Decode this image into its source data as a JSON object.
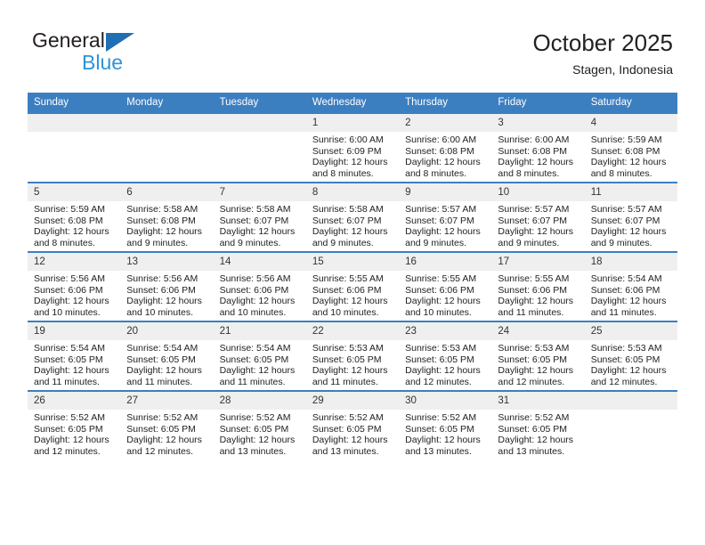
{
  "brand": {
    "name_dark": "General",
    "name_blue": "Blue",
    "accent_blue": "#2e93d8",
    "triangle_blue": "#1f6fb5"
  },
  "header": {
    "title": "October 2025",
    "subtitle": "Stagen, Indonesia"
  },
  "theme": {
    "header_bg": "#3c7fc1",
    "header_text": "#ffffff",
    "daynum_bg": "#efefef",
    "cell_bg": "#ffffff"
  },
  "weekdays": [
    "Sunday",
    "Monday",
    "Tuesday",
    "Wednesday",
    "Thursday",
    "Friday",
    "Saturday"
  ],
  "labels": {
    "sunrise_prefix": "Sunrise:",
    "sunset_prefix": "Sunset:",
    "daylight_prefix": "Daylight:"
  },
  "weeks": [
    [
      {
        "day": "",
        "sunrise": "",
        "sunset": "",
        "daylight_line1": "",
        "daylight_line2": ""
      },
      {
        "day": "",
        "sunrise": "",
        "sunset": "",
        "daylight_line1": "",
        "daylight_line2": ""
      },
      {
        "day": "",
        "sunrise": "",
        "sunset": "",
        "daylight_line1": "",
        "daylight_line2": ""
      },
      {
        "day": "1",
        "sunrise": "Sunrise: 6:00 AM",
        "sunset": "Sunset: 6:09 PM",
        "daylight_line1": "Daylight: 12 hours",
        "daylight_line2": "and 8 minutes."
      },
      {
        "day": "2",
        "sunrise": "Sunrise: 6:00 AM",
        "sunset": "Sunset: 6:08 PM",
        "daylight_line1": "Daylight: 12 hours",
        "daylight_line2": "and 8 minutes."
      },
      {
        "day": "3",
        "sunrise": "Sunrise: 6:00 AM",
        "sunset": "Sunset: 6:08 PM",
        "daylight_line1": "Daylight: 12 hours",
        "daylight_line2": "and 8 minutes."
      },
      {
        "day": "4",
        "sunrise": "Sunrise: 5:59 AM",
        "sunset": "Sunset: 6:08 PM",
        "daylight_line1": "Daylight: 12 hours",
        "daylight_line2": "and 8 minutes."
      }
    ],
    [
      {
        "day": "5",
        "sunrise": "Sunrise: 5:59 AM",
        "sunset": "Sunset: 6:08 PM",
        "daylight_line1": "Daylight: 12 hours",
        "daylight_line2": "and 8 minutes."
      },
      {
        "day": "6",
        "sunrise": "Sunrise: 5:58 AM",
        "sunset": "Sunset: 6:08 PM",
        "daylight_line1": "Daylight: 12 hours",
        "daylight_line2": "and 9 minutes."
      },
      {
        "day": "7",
        "sunrise": "Sunrise: 5:58 AM",
        "sunset": "Sunset: 6:07 PM",
        "daylight_line1": "Daylight: 12 hours",
        "daylight_line2": "and 9 minutes."
      },
      {
        "day": "8",
        "sunrise": "Sunrise: 5:58 AM",
        "sunset": "Sunset: 6:07 PM",
        "daylight_line1": "Daylight: 12 hours",
        "daylight_line2": "and 9 minutes."
      },
      {
        "day": "9",
        "sunrise": "Sunrise: 5:57 AM",
        "sunset": "Sunset: 6:07 PM",
        "daylight_line1": "Daylight: 12 hours",
        "daylight_line2": "and 9 minutes."
      },
      {
        "day": "10",
        "sunrise": "Sunrise: 5:57 AM",
        "sunset": "Sunset: 6:07 PM",
        "daylight_line1": "Daylight: 12 hours",
        "daylight_line2": "and 9 minutes."
      },
      {
        "day": "11",
        "sunrise": "Sunrise: 5:57 AM",
        "sunset": "Sunset: 6:07 PM",
        "daylight_line1": "Daylight: 12 hours",
        "daylight_line2": "and 9 minutes."
      }
    ],
    [
      {
        "day": "12",
        "sunrise": "Sunrise: 5:56 AM",
        "sunset": "Sunset: 6:06 PM",
        "daylight_line1": "Daylight: 12 hours",
        "daylight_line2": "and 10 minutes."
      },
      {
        "day": "13",
        "sunrise": "Sunrise: 5:56 AM",
        "sunset": "Sunset: 6:06 PM",
        "daylight_line1": "Daylight: 12 hours",
        "daylight_line2": "and 10 minutes."
      },
      {
        "day": "14",
        "sunrise": "Sunrise: 5:56 AM",
        "sunset": "Sunset: 6:06 PM",
        "daylight_line1": "Daylight: 12 hours",
        "daylight_line2": "and 10 minutes."
      },
      {
        "day": "15",
        "sunrise": "Sunrise: 5:55 AM",
        "sunset": "Sunset: 6:06 PM",
        "daylight_line1": "Daylight: 12 hours",
        "daylight_line2": "and 10 minutes."
      },
      {
        "day": "16",
        "sunrise": "Sunrise: 5:55 AM",
        "sunset": "Sunset: 6:06 PM",
        "daylight_line1": "Daylight: 12 hours",
        "daylight_line2": "and 10 minutes."
      },
      {
        "day": "17",
        "sunrise": "Sunrise: 5:55 AM",
        "sunset": "Sunset: 6:06 PM",
        "daylight_line1": "Daylight: 12 hours",
        "daylight_line2": "and 11 minutes."
      },
      {
        "day": "18",
        "sunrise": "Sunrise: 5:54 AM",
        "sunset": "Sunset: 6:06 PM",
        "daylight_line1": "Daylight: 12 hours",
        "daylight_line2": "and 11 minutes."
      }
    ],
    [
      {
        "day": "19",
        "sunrise": "Sunrise: 5:54 AM",
        "sunset": "Sunset: 6:05 PM",
        "daylight_line1": "Daylight: 12 hours",
        "daylight_line2": "and 11 minutes."
      },
      {
        "day": "20",
        "sunrise": "Sunrise: 5:54 AM",
        "sunset": "Sunset: 6:05 PM",
        "daylight_line1": "Daylight: 12 hours",
        "daylight_line2": "and 11 minutes."
      },
      {
        "day": "21",
        "sunrise": "Sunrise: 5:54 AM",
        "sunset": "Sunset: 6:05 PM",
        "daylight_line1": "Daylight: 12 hours",
        "daylight_line2": "and 11 minutes."
      },
      {
        "day": "22",
        "sunrise": "Sunrise: 5:53 AM",
        "sunset": "Sunset: 6:05 PM",
        "daylight_line1": "Daylight: 12 hours",
        "daylight_line2": "and 11 minutes."
      },
      {
        "day": "23",
        "sunrise": "Sunrise: 5:53 AM",
        "sunset": "Sunset: 6:05 PM",
        "daylight_line1": "Daylight: 12 hours",
        "daylight_line2": "and 12 minutes."
      },
      {
        "day": "24",
        "sunrise": "Sunrise: 5:53 AM",
        "sunset": "Sunset: 6:05 PM",
        "daylight_line1": "Daylight: 12 hours",
        "daylight_line2": "and 12 minutes."
      },
      {
        "day": "25",
        "sunrise": "Sunrise: 5:53 AM",
        "sunset": "Sunset: 6:05 PM",
        "daylight_line1": "Daylight: 12 hours",
        "daylight_line2": "and 12 minutes."
      }
    ],
    [
      {
        "day": "26",
        "sunrise": "Sunrise: 5:52 AM",
        "sunset": "Sunset: 6:05 PM",
        "daylight_line1": "Daylight: 12 hours",
        "daylight_line2": "and 12 minutes."
      },
      {
        "day": "27",
        "sunrise": "Sunrise: 5:52 AM",
        "sunset": "Sunset: 6:05 PM",
        "daylight_line1": "Daylight: 12 hours",
        "daylight_line2": "and 12 minutes."
      },
      {
        "day": "28",
        "sunrise": "Sunrise: 5:52 AM",
        "sunset": "Sunset: 6:05 PM",
        "daylight_line1": "Daylight: 12 hours",
        "daylight_line2": "and 13 minutes."
      },
      {
        "day": "29",
        "sunrise": "Sunrise: 5:52 AM",
        "sunset": "Sunset: 6:05 PM",
        "daylight_line1": "Daylight: 12 hours",
        "daylight_line2": "and 13 minutes."
      },
      {
        "day": "30",
        "sunrise": "Sunrise: 5:52 AM",
        "sunset": "Sunset: 6:05 PM",
        "daylight_line1": "Daylight: 12 hours",
        "daylight_line2": "and 13 minutes."
      },
      {
        "day": "31",
        "sunrise": "Sunrise: 5:52 AM",
        "sunset": "Sunset: 6:05 PM",
        "daylight_line1": "Daylight: 12 hours",
        "daylight_line2": "and 13 minutes."
      },
      {
        "day": "",
        "sunrise": "",
        "sunset": "",
        "daylight_line1": "",
        "daylight_line2": ""
      }
    ]
  ]
}
